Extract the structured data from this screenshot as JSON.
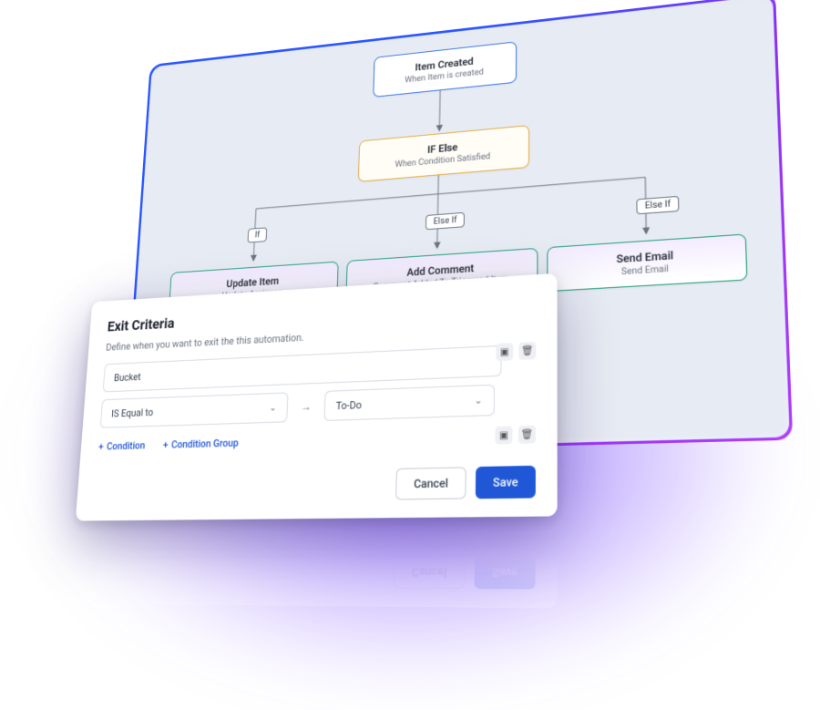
{
  "flow": {
    "trigger": {
      "title": "Item Created",
      "sub": "When Item is created"
    },
    "condition": {
      "title": "IF Else",
      "sub": "When Condition Satisfied"
    },
    "branches": {
      "if": "If",
      "elseif1": "Else If",
      "elseif2": "Else If"
    },
    "actions": [
      {
        "title": "Update Item",
        "sub": "Update Assignee"
      },
      {
        "title": "Add Comment",
        "sub": "Comment Added To Triggered Item"
      },
      {
        "title": "Send Email",
        "sub": "Send Email"
      }
    ]
  },
  "modal": {
    "title": "Exit Criteria",
    "desc": "Define when you want to exit the this automation.",
    "field": "Bucket",
    "operator": "IS Equal to",
    "value": "To-Do",
    "add_condition": "Condition",
    "add_group": "Condition Group",
    "cancel": "Cancel",
    "save": "Save"
  },
  "icons": {
    "plus": "+",
    "arrow_right": "→",
    "chevron_down": "⌄",
    "collapse": "▣",
    "trash": "🗑"
  }
}
